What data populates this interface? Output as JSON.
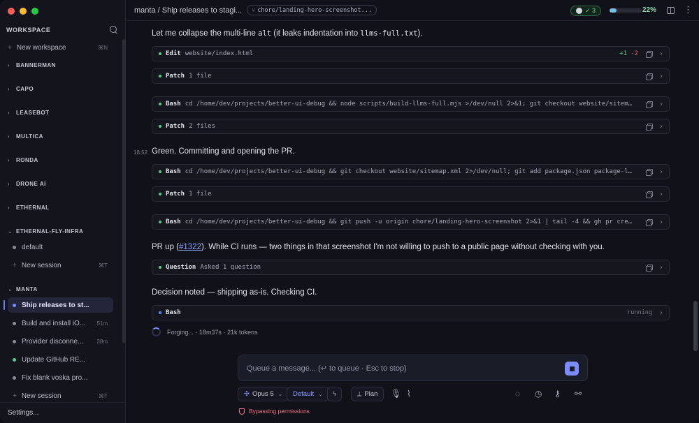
{
  "window": {
    "traffic_colors": [
      "#ff5f57",
      "#febc2e",
      "#28c840"
    ]
  },
  "sidebar": {
    "title": "WORKSPACE",
    "new_workspace": {
      "label": "New workspace",
      "shortcut": "⌘N"
    },
    "groups_collapsed": [
      "BANNERMAN",
      "CAPO",
      "LEASEBOT",
      "MULTICA",
      "RONDA",
      "DRONE AI",
      "ETHERNAL"
    ],
    "group_eff": {
      "name": "ETHERNAL-FLY-INFRA",
      "sessions": [
        {
          "label": "default",
          "status": "grey"
        }
      ],
      "new_session": {
        "label": "New session",
        "shortcut": "⌘T"
      }
    },
    "group_manta": {
      "name": "MANTA",
      "sessions": [
        {
          "label": "Ship releases to st...",
          "status": "blue",
          "meta": ""
        },
        {
          "label": "Build and install iO...",
          "status": "grey",
          "meta": "51m"
        },
        {
          "label": "Provider disconne...",
          "status": "grey",
          "meta": "38m"
        },
        {
          "label": "Update GitHub RE...",
          "status": "green",
          "meta": ""
        },
        {
          "label": "Fix blank voska pro...",
          "status": "grey",
          "meta": ""
        }
      ],
      "new_session": {
        "label": "New session",
        "shortcut": "⌘T"
      }
    },
    "settings": "Settings..."
  },
  "topbar": {
    "breadcrumb": "manta / Ship releases to stagi...",
    "branch": "chore/landing-hero-screenshot...",
    "github_checks": "✓ 3",
    "progress": 0.22,
    "progress_label": "22%"
  },
  "conversation": {
    "msg1_pre": "Let me collapse the multi-line ",
    "msg1_code1": "alt",
    "msg1_mid": " (it leaks indentation into ",
    "msg1_code2": "llms-full.txt",
    "msg1_post": ").",
    "tools1": [
      {
        "name": "Edit",
        "arg": "website/index.html",
        "plus": "+1",
        "minus": "-2"
      },
      {
        "name": "Patch",
        "arg": "1 file"
      },
      {
        "name": "Bash",
        "arg": "cd /home/dev/projects/better-ui-debug && node scripts/build-llms-full.mjs >/dev/null 2>&1; git checkout website/sitemap..."
      },
      {
        "name": "Patch",
        "arg": "2 files"
      }
    ],
    "timestamp": "18:52",
    "msg2": "Green. Committing and opening the PR.",
    "tools2": [
      {
        "name": "Bash",
        "arg": "cd /home/dev/projects/better-ui-debug && git checkout website/sitemap.xml 2>/dev/null; git add package.json package-loc..."
      },
      {
        "name": "Patch",
        "arg": "1 file"
      },
      {
        "name": "Bash",
        "arg": "cd /home/dev/projects/better-ui-debug && git push -u origin chore/landing-hero-screenshot 2>&1 | tail -4 && gh pr creat..."
      }
    ],
    "msg3_pre": "PR up (",
    "msg3_link": "#1322",
    "msg3_post": "). While CI runs — two things in that screenshot I'm not willing to push to a public page without checking with you.",
    "tool_question": {
      "name": "Question",
      "arg": "Asked 1 question"
    },
    "msg4": "Decision noted — shipping as-is. Checking CI.",
    "tool_running": {
      "name": "Bash",
      "status": "running"
    },
    "forging": "Forging... · 18m37s · 21k tokens"
  },
  "composer": {
    "placeholder": "Queue a message...  (↵ to queue · Esc to stop)",
    "model": "Opus 5",
    "mode": "Default",
    "plan": "Plan",
    "bypass": "Bypassing permissions"
  }
}
